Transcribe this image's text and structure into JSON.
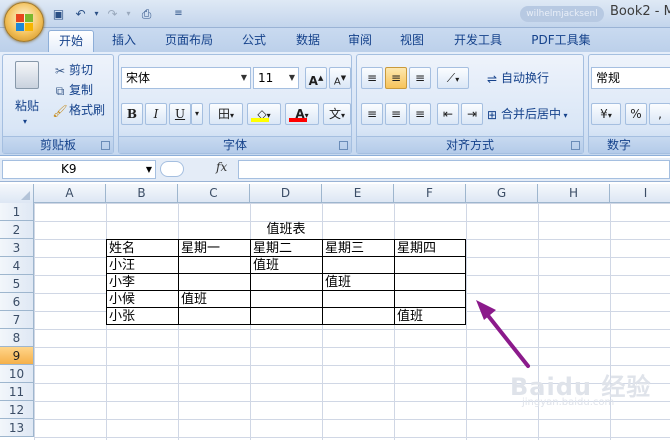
{
  "window": {
    "doc_title": "Book2 - M",
    "user_label": "wilhelmjacksenl"
  },
  "tabs": [
    {
      "label": "开始",
      "active": true
    },
    {
      "label": "插入",
      "active": false
    },
    {
      "label": "页面布局",
      "active": false
    },
    {
      "label": "公式",
      "active": false
    },
    {
      "label": "数据",
      "active": false
    },
    {
      "label": "审阅",
      "active": false
    },
    {
      "label": "视图",
      "active": false
    },
    {
      "label": "开发工具",
      "active": false
    },
    {
      "label": "PDF工具集",
      "active": false
    }
  ],
  "ribbon": {
    "clipboard": {
      "label": "剪贴板",
      "paste": "粘贴",
      "cut": "剪切",
      "copy": "复制",
      "format_painter": "格式刷"
    },
    "font": {
      "label": "字体",
      "font_name": "宋体",
      "font_size": "11",
      "grow": "A",
      "shrink": "A",
      "bold": "B",
      "italic": "I",
      "underline": "U",
      "border": "田",
      "fill_glyph": "◇",
      "font_color_glyph": "A",
      "phonetic": "文",
      "fill_color": "#ffff00",
      "font_color": "#ff0000"
    },
    "alignment": {
      "label": "对齐方式",
      "wrap_text": "自动换行",
      "merge_center": "合并后居中"
    },
    "number": {
      "label": "数字",
      "format": "常规",
      "percent": "%"
    }
  },
  "formula_bar": {
    "name_box": "K9",
    "fx": "fx",
    "value": ""
  },
  "sheet": {
    "columns": [
      "A",
      "B",
      "C",
      "D",
      "E",
      "F",
      "G",
      "H",
      "I"
    ],
    "rows": [
      "1",
      "2",
      "3",
      "4",
      "5",
      "6",
      "7",
      "8",
      "9",
      "10",
      "11",
      "12",
      "13"
    ],
    "selected_row": "9",
    "title": "值班表",
    "table_header": [
      "姓名",
      "星期一",
      "星期二",
      "星期三",
      "星期四"
    ],
    "table_rows": [
      [
        "小汪",
        "",
        "值班",
        "",
        ""
      ],
      [
        "小李",
        "",
        "",
        "值班",
        ""
      ],
      [
        "小候",
        "值班",
        "",
        "",
        ""
      ],
      [
        "小张",
        "",
        "",
        "",
        "值班"
      ]
    ]
  },
  "watermark": {
    "text": "Baidu 经验",
    "sub": "jingyan.baidu.com"
  },
  "annotation_color": "#8b1a8b"
}
